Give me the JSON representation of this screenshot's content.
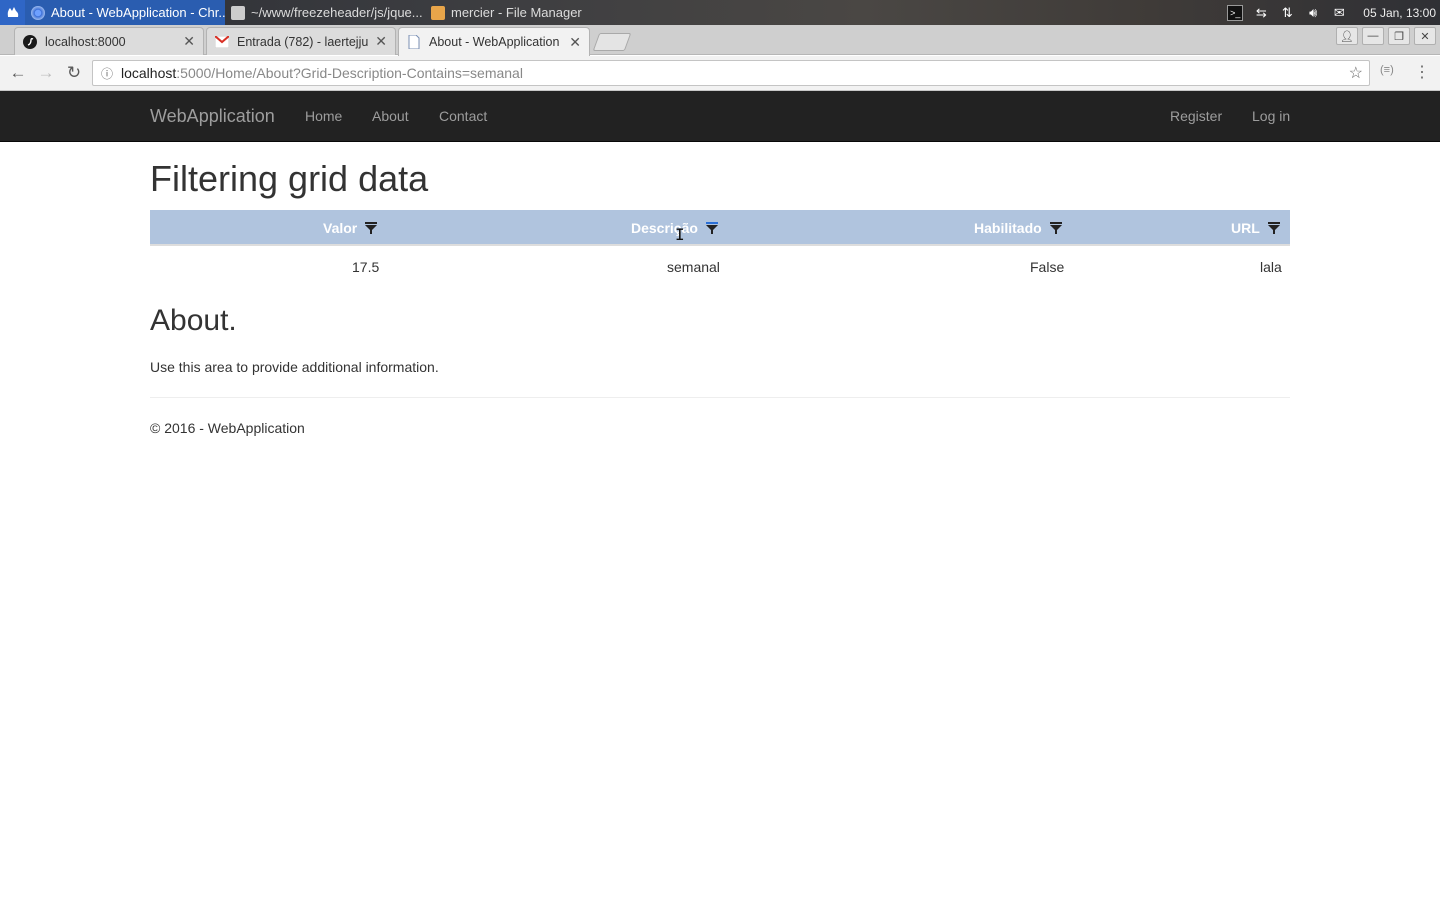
{
  "os": {
    "tasks": [
      {
        "label": "About - WebApplication - Chr...",
        "active": true
      },
      {
        "label": "~/www/freezeheader/js/jque...",
        "active": false
      },
      {
        "label": "mercier - File Manager",
        "active": false
      }
    ],
    "clock": "05 Jan, 13:00"
  },
  "browser": {
    "tabs": [
      {
        "label": "localhost:8000"
      },
      {
        "label": "Entrada (782) - laertejju"
      },
      {
        "label": "About - WebApplication"
      }
    ],
    "url_host": "localhost",
    "url_path": ":5000/Home/About?Grid-Description-Contains=semanal"
  },
  "site": {
    "brand": "WebApplication",
    "nav": {
      "home": "Home",
      "about": "About",
      "contact": "Contact"
    },
    "auth": {
      "register": "Register",
      "login": "Log in"
    }
  },
  "main": {
    "title": "Filtering grid data",
    "grid": {
      "columns": [
        "Valor",
        "Descrição",
        "Habilitado",
        "URL"
      ],
      "rows": [
        [
          "17.5",
          "semanal",
          "False",
          "lala"
        ]
      ]
    },
    "about_heading": "About.",
    "about_text": "Use this area to provide additional information.",
    "footer": "© 2016 - WebApplication"
  },
  "colors": {
    "navbar_bg": "#222222",
    "grid_header_bg": "#b0c4de",
    "os_active_task": "#2a5db0"
  }
}
